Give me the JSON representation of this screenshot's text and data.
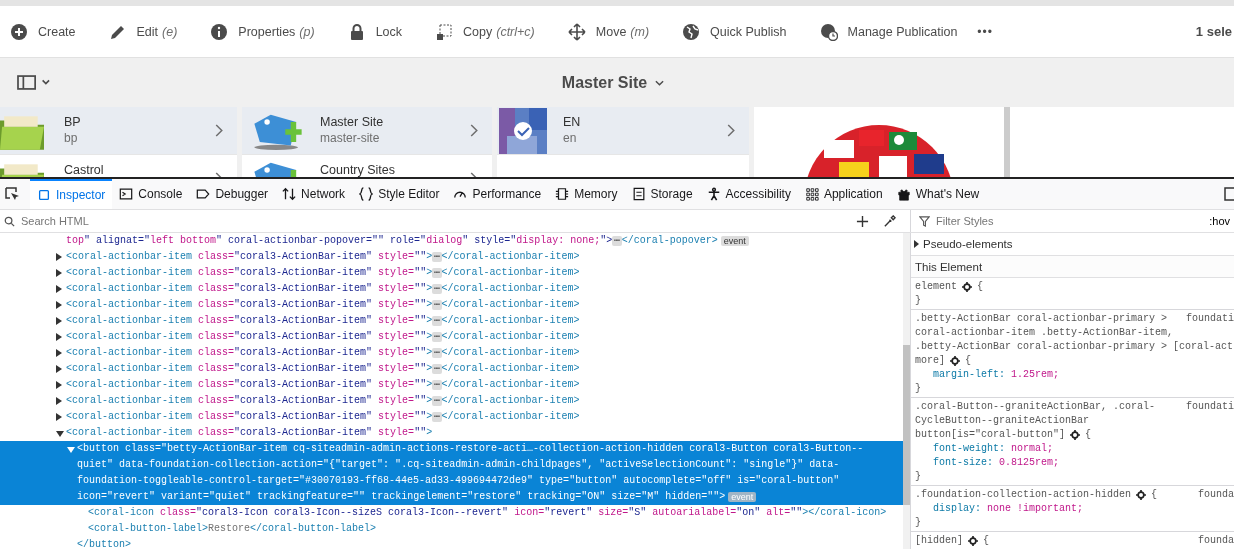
{
  "toolbar": {
    "actions": [
      {
        "label": "Create"
      },
      {
        "label": "Edit",
        "shortcut": "(e)"
      },
      {
        "label": "Properties",
        "shortcut": "(p)"
      },
      {
        "label": "Lock"
      },
      {
        "label": "Copy",
        "shortcut": "(ctrl+c)"
      },
      {
        "label": "Move",
        "shortcut": "(m)"
      },
      {
        "label": "Quick Publish"
      },
      {
        "label": "Manage Publication"
      }
    ],
    "more": "•••",
    "selection_count": "1 sele"
  },
  "title_bar": {
    "title": "Master Site"
  },
  "columns": [
    {
      "items": [
        {
          "title": "BP",
          "subtitle": "bp",
          "selected": true
        },
        {
          "title": "Castrol",
          "selected": false
        }
      ]
    },
    {
      "items": [
        {
          "title": "Master Site",
          "subtitle": "master-site",
          "selected": true
        },
        {
          "title": "Country Sites",
          "selected": false
        }
      ]
    },
    {
      "items": [
        {
          "title": "EN",
          "subtitle": "en",
          "selected": true
        }
      ]
    }
  ],
  "devtools": {
    "tabs": [
      {
        "label": "Inspector",
        "selected": true
      },
      {
        "label": "Console",
        "selected": false
      },
      {
        "label": "Debugger",
        "selected": false
      },
      {
        "label": "Network",
        "selected": false
      },
      {
        "label": "Style Editor",
        "selected": false
      },
      {
        "label": "Performance",
        "selected": false
      },
      {
        "label": "Memory",
        "selected": false
      },
      {
        "label": "Storage",
        "selected": false
      },
      {
        "label": "Accessibility",
        "selected": false
      },
      {
        "label": "Application",
        "selected": false
      },
      {
        "label": "What's New",
        "selected": false
      }
    ],
    "search": {
      "placeholder": "Search HTML"
    },
    "filter": {
      "placeholder": "Filter Styles"
    },
    "hov": ":hov"
  },
  "html_tree": [
    {
      "markup": "top\" alignat=\"left bottom\" coral-actionbar-popover=\"\" role=\"dialog\" style=\"display: none;\">",
      "ellipsis": "⋯",
      "close": "</coral-popover>",
      "event": "event",
      "selected": false
    },
    {
      "markup": "<coral-actionbar-item class=\"coral3-ActionBar-item\" style=\"\">",
      "ellipsis": "⋯",
      "close": "</coral-actionbar-item>",
      "expanded": false,
      "selected": false
    },
    {
      "markup": "<coral-actionbar-item class=\"coral3-ActionBar-item\" style=\"\">",
      "ellipsis": "⋯",
      "close": "</coral-actionbar-item>",
      "expanded": false,
      "selected": false
    },
    {
      "markup": "<coral-actionbar-item class=\"coral3-ActionBar-item\" style=\"\">",
      "ellipsis": "⋯",
      "close": "</coral-actionbar-item>",
      "expanded": false,
      "selected": false
    },
    {
      "markup": "<coral-actionbar-item class=\"coral3-ActionBar-item\" style=\"\">",
      "ellipsis": "⋯",
      "close": "</coral-actionbar-item>",
      "expanded": false,
      "selected": false
    },
    {
      "markup": "<coral-actionbar-item class=\"coral3-ActionBar-item\" style=\"\">",
      "ellipsis": "⋯",
      "close": "</coral-actionbar-item>",
      "expanded": false,
      "selected": false
    },
    {
      "markup": "<coral-actionbar-item class=\"coral3-ActionBar-item\" style=\"\">",
      "ellipsis": "⋯",
      "close": "</coral-actionbar-item>",
      "expanded": false,
      "selected": false
    },
    {
      "markup": "<coral-actionbar-item class=\"coral3-ActionBar-item\" style=\"\">",
      "ellipsis": "⋯",
      "close": "</coral-actionbar-item>",
      "expanded": false,
      "selected": false
    },
    {
      "markup": "<coral-actionbar-item class=\"coral3-ActionBar-item\" style=\"\">",
      "ellipsis": "⋯",
      "close": "</coral-actionbar-item>",
      "expanded": false,
      "selected": false
    },
    {
      "markup": "<coral-actionbar-item class=\"coral3-ActionBar-item\" style=\"\">",
      "ellipsis": "⋯",
      "close": "</coral-actionbar-item>",
      "expanded": false,
      "selected": false
    },
    {
      "markup": "<coral-actionbar-item class=\"coral3-ActionBar-item\" style=\"\">",
      "ellipsis": "⋯",
      "close": "</coral-actionbar-item>",
      "expanded": false,
      "selected": false
    },
    {
      "markup": "<coral-actionbar-item class=\"coral3-ActionBar-item\" style=\"\">",
      "ellipsis": "⋯",
      "close": "</coral-actionbar-item>",
      "expanded": false,
      "selected": false
    },
    {
      "markup": "<coral-actionbar-item class=\"coral3-ActionBar-item\" style=\"\">",
      "expanded": true,
      "selected": false,
      "children": [
        {
          "markup": "<button class=\"betty-ActionBar-item cq-siteadmin-admin-actions-restore-acti…-collection-action-hidden coral3-Button coral3-Button--quiet\" data-foundation-collection-action=\"{\"target\": \".cq-siteadmin-admin-childpages\", \"activeSelectionCount\": \"single\"}\" data-foundation-toggleable-control-target=\"#30070193-ff68-44e5-ad33-499694472de9\" type=\"button\" autocomplete=\"off\" is=\"coral-button\" icon=\"revert\" variant=\"quiet\" trackingfeature=\"\" trackingelement=\"restore\" tracking=\"ON\" size=\"M\" hidden=\"\">",
          "event": "event",
          "expanded": true,
          "selected": true,
          "close": "</button>",
          "children": [
            {
              "markup": "<coral-icon class=\"coral3-Icon coral3-Icon--sizeS coral3-Icon--revert\" icon=\"revert\" size=\"S\" autoarialabel=\"on\" alt=\"\"></coral-icon>",
              "selected": false
            },
            {
              "markup": "<coral-button-label>Restore</coral-button-label>",
              "selected": false
            }
          ]
        }
      ]
    }
  ],
  "styles": {
    "pseudo_elements": {
      "label": "Pseudo-elements",
      "expanded": false
    },
    "section_title": "This Element",
    "rules": [
      {
        "selector_lines": [
          "element"
        ],
        "open": "{",
        "close": "}"
      },
      {
        "selector_lines": [
          ".betty-ActionBar coral-actionbar-primary >",
          "coral-actionbar-item .betty-ActionBar-item,",
          ".betty-ActionBar coral-actionbar-primary > [coral-act",
          "more]"
        ],
        "source": "foundati",
        "open": "{",
        "declarations": [
          {
            "property": "margin-left:",
            "value": "1.25rem;"
          }
        ],
        "close": "}"
      },
      {
        "selector_lines": [
          ".coral-Button--graniteActionBar, .coral-",
          "CycleButton--graniteActionBar",
          "button[is=\"coral-button\"]"
        ],
        "source": "foundati",
        "open": "{",
        "declarations": [
          {
            "property": "font-weight:",
            "value": "normal;"
          },
          {
            "property": "font-size:",
            "value": "0.8125rem;"
          }
        ],
        "close": "}"
      },
      {
        "selector_lines": [
          ".foundation-collection-action-hidden"
        ],
        "source": "founda",
        "open": "{",
        "declarations": [
          {
            "property": "display:",
            "value": "none !important;"
          }
        ],
        "close": "}"
      },
      {
        "selector_lines": [
          "[hidden]"
        ],
        "source": "founda",
        "open": "{"
      }
    ]
  }
}
